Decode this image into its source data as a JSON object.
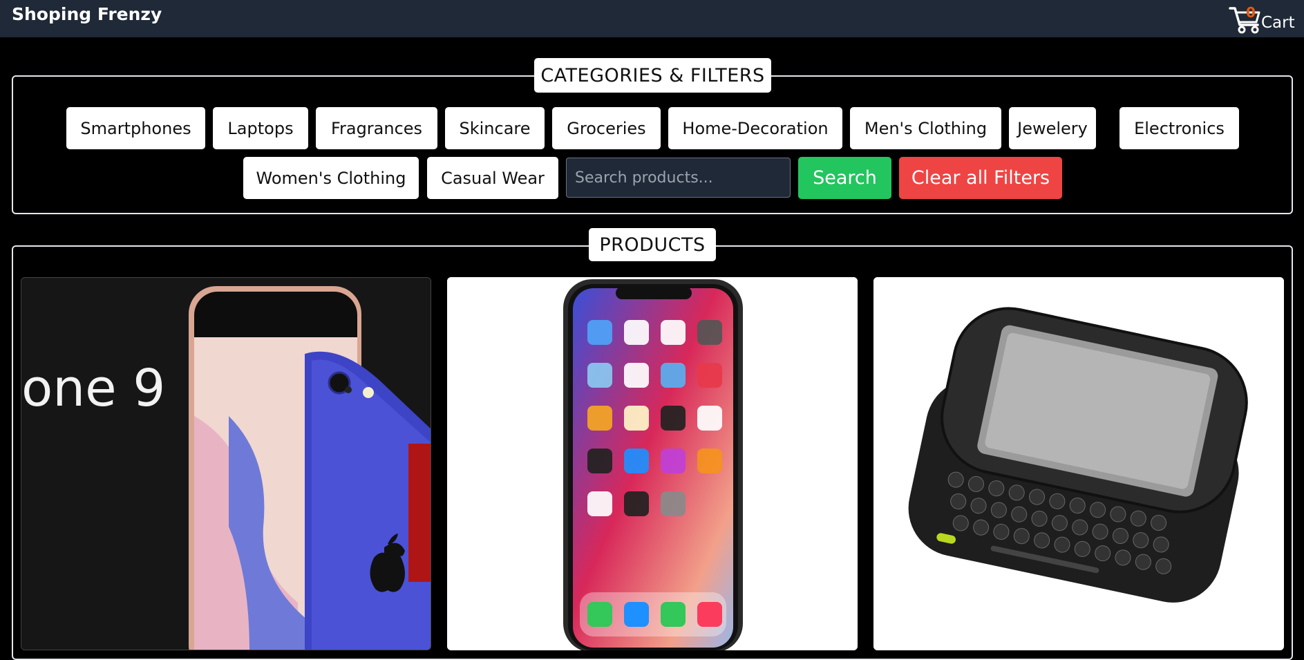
{
  "header": {
    "brand": "Shoping Frenzy",
    "cart_count": "0",
    "cart_label": "Cart"
  },
  "filters": {
    "legend": "CATEGORIES & FILTERS",
    "categories": [
      "Smartphones",
      "Laptops",
      "Fragrances",
      "Skincare",
      "Groceries",
      "Home-Decoration",
      "Men's Clothing",
      "Jewelery",
      "Electronics",
      "Women's Clothing",
      "Casual Wear"
    ],
    "search_placeholder": "Search products...",
    "search_label": "Search",
    "clear_label": "Clear all Filters"
  },
  "products": {
    "legend": "PRODUCTS",
    "items": [
      {
        "image_text": "one 9",
        "image": "iphone-9-image"
      },
      {
        "image": "iphone-x-image"
      },
      {
        "image": "slider-keyboard-phone-image"
      }
    ]
  },
  "colors": {
    "navbar": "#1f2937",
    "search_button": "#22c55e",
    "clear_button": "#ef4444",
    "cart_count": "#ea580c"
  }
}
